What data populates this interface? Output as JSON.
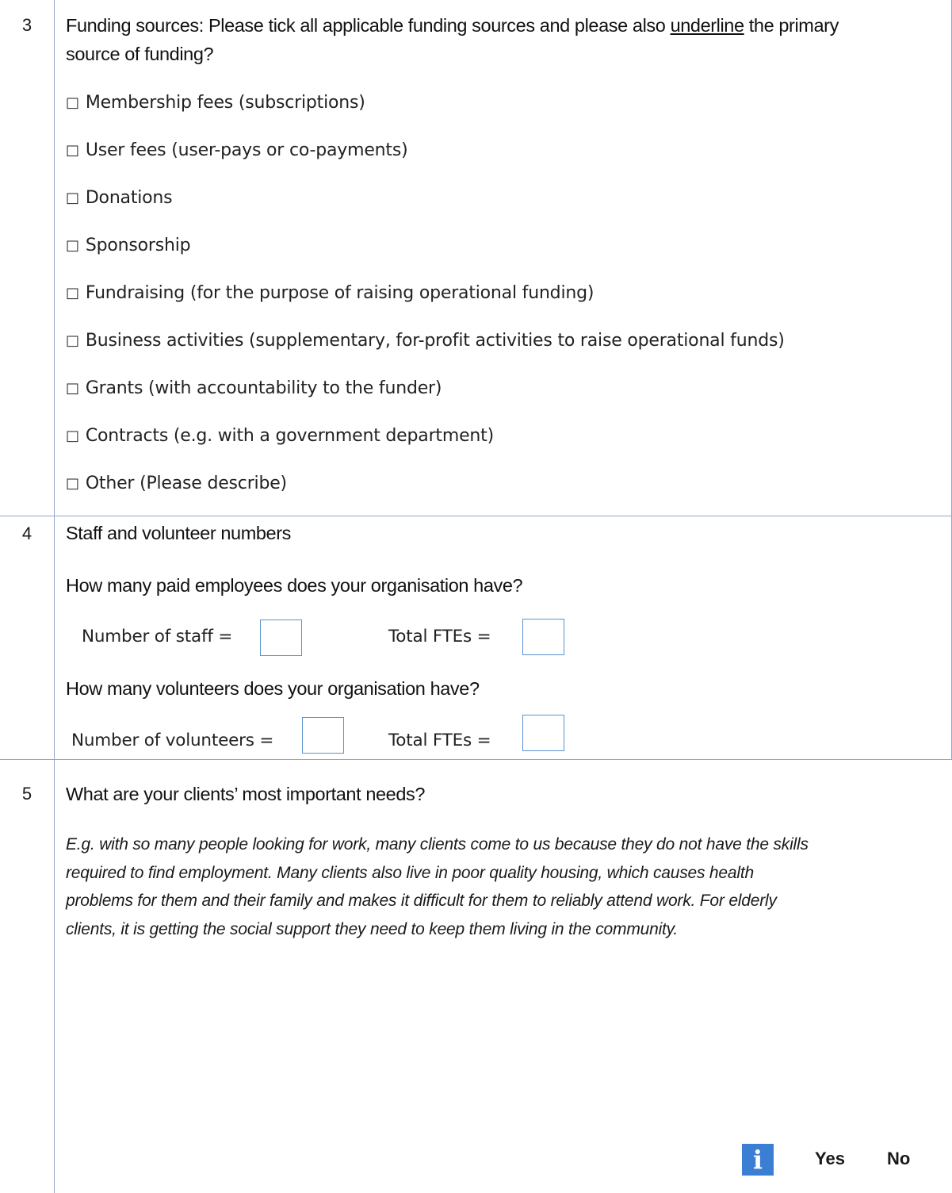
{
  "rows": {
    "q3": {
      "number": "3",
      "title_before": "Funding sources: Please tick all applicable funding sources and please also ",
      "title_underlined": "underline",
      "title_after": " the primary",
      "title_line2": "source of funding?",
      "checkbox_glyph": "□",
      "options": [
        "Membership fees (subscriptions)",
        "User fees (user-pays or co-payments)",
        "Donations",
        "Sponsorship",
        "Fundraising (for the purpose of raising operational funding)",
        "Business activities (supplementary, for-profit activities to raise operational funds)",
        "Grants (with accountability to the funder)",
        "Contracts (e.g. with a government department)",
        "Other (Please describe)"
      ]
    },
    "q4": {
      "number": "4",
      "title": "Staff and volunteer numbers",
      "paid_question": "How many paid employees does your organisation have?",
      "staff_label": "Number of staff =",
      "staff_fte_label": "Total FTEs =",
      "volunteer_question": "How many volunteers does your organisation have?",
      "volunteer_label": "Number of volunteers =",
      "volunteer_fte_label": "Total FTEs ="
    },
    "q5": {
      "number": "5",
      "title": "What are your clients’ most important needs?",
      "example_lines": [
        "E.g. with so many people looking for work, many clients come to us because they do not have the skills",
        "required to find employment.  Many clients also live in poor quality housing, which causes health",
        "problems for them and their family and makes it difficult for them to reliably attend work.  For elderly",
        "clients, it is getting the social support they need to keep them living in the community."
      ]
    }
  },
  "footer": {
    "info_icon": "info-icon",
    "info_glyph": "i",
    "yes_label": "Yes",
    "no_label": "No"
  },
  "colors": {
    "grid": "#8fa9c8",
    "input_border": "#5b93cf",
    "info_icon_bg": "#3a7fd4"
  }
}
